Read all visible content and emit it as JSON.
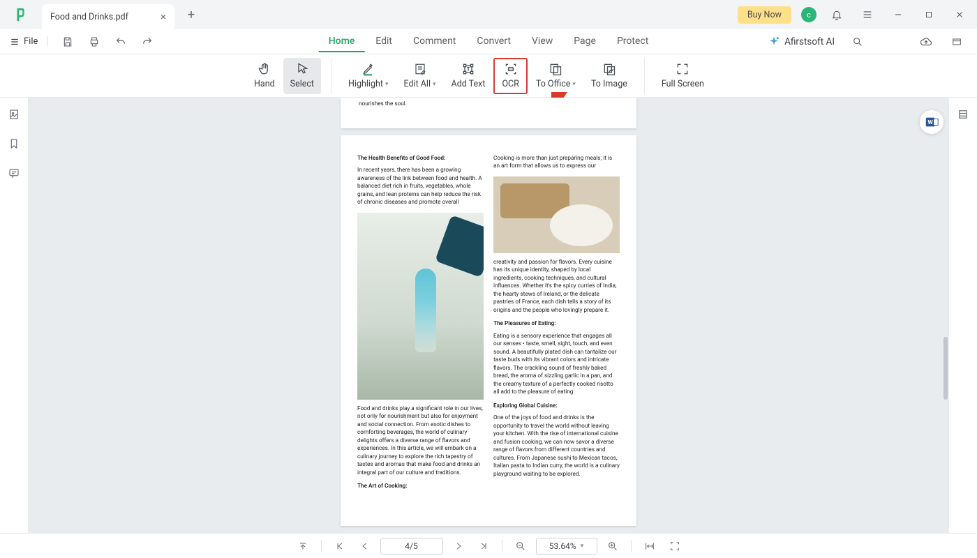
{
  "titlebar": {
    "tab_title": "Food and Drinks.pdf",
    "buy_now": "Buy Now",
    "avatar_letter": "c"
  },
  "menubar": {
    "file": "File",
    "tabs": [
      "Home",
      "Edit",
      "Comment",
      "Convert",
      "View",
      "Page",
      "Protect"
    ],
    "active_tab": 0,
    "ai_label": "Afirstsoft AI"
  },
  "toolbar": {
    "hand": "Hand",
    "select": "Select",
    "highlight": "Highlight",
    "edit_all": "Edit All",
    "add_text": "Add Text",
    "ocr": "OCR",
    "to_office": "To Office",
    "to_image": "To Image",
    "full_screen": "Full Screen"
  },
  "document": {
    "page1_tail": "nourishes the soul.",
    "col1": {
      "h1": "The Health Benefits of Good Food:",
      "p1": "In recent years, there has been a growing awareness of the link between food and health. A balanced diet rich in fruits, vegetables, whole grains, and lean proteins can help reduce the risk of chronic diseases and promote overall",
      "p2": "Food and drinks play a significant role in our lives, not only for nourishment but also for enjoyment and social connection. From exotic dishes to comforting beverages, the world of culinary delights offers a diverse range of flavors and experiences. In this article, we will embark on a culinary journey to explore the rich tapestry of tastes and aromas that make food and drinks an integral part of our culture and traditions.",
      "h2": "The Art of Cooking:"
    },
    "col2": {
      "p0": "Cooking is more than just preparing meals; it is an art form that allows us to express our",
      "p1": "creativity and passion for flavors. Every cuisine has its unique identity, shaped by local ingredients, cooking techniques, and cultural influences. Whether it's the spicy curries of India, the hearty stews of Ireland, or the delicate pastries of France, each dish tells a story of its origins and the people who lovingly prepare it.",
      "h1": "The Pleasures of Eating:",
      "p2": "Eating is a sensory experience that engages all our senses • taste, smell, sight, touch, and even sound. A beautifully plated dish can tantalize our taste buds with its vibrant colors and intricate flavors. The crackling sound of freshly baked bread, the aroma of sizzling garlic in a pan, and the creamy texture of a perfectly cooked risotto all add to the pleasure of eating.",
      "h2": "Exploring Global Cuisine:",
      "p3": "One of the joys of food and drinks is the opportunity to travel the world without leaving your kitchen. With the rise of international cuisine and fusion cooking, we can now savor a diverse range of flavors from different countries and cultures. From Japanese sushi to Mexican tacos, Italian pasta to Indian curry, the world is a culinary playground waiting to be explored."
    }
  },
  "statusbar": {
    "page": "4/5",
    "zoom": "53.64%"
  }
}
